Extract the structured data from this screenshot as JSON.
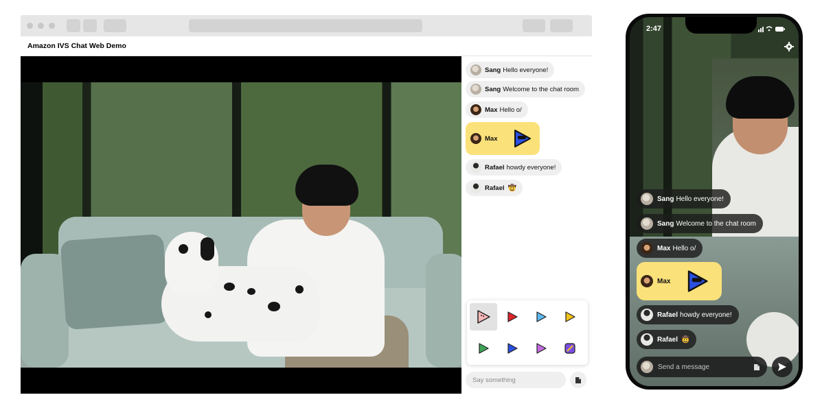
{
  "web": {
    "app_title": "Amazon IVS Chat Web Demo",
    "chat": {
      "messages": [
        {
          "user": "Sang",
          "text": "Hello everyone!",
          "avatar": "avatar-sang"
        },
        {
          "user": "Sang",
          "text": "Welcome to the chat room",
          "avatar": "avatar-sang"
        },
        {
          "user": "Max",
          "text": "Hello o/",
          "avatar": "avatar-max"
        },
        {
          "user": "Max",
          "text": "",
          "sticker": "blue-cool-sticker",
          "avatar": "avatar-max"
        },
        {
          "user": "Rafael",
          "text": "howdy everyone!",
          "avatar": "avatar-rafael"
        },
        {
          "user": "Rafael",
          "text": "",
          "emoji": "🤠",
          "avatar": "avatar-rafael"
        }
      ],
      "sticker_picker": {
        "stickers": [
          "pink-sticker",
          "red-sticker",
          "blue-sticker",
          "yellow-sticker",
          "green-sticker",
          "navy-sticker",
          "purple-sticker",
          "rocket-sticker"
        ],
        "selected_index": 0
      },
      "composer_placeholder": "Say something",
      "sticker_button_icon": "sticker-icon"
    }
  },
  "phone": {
    "time": "2:47",
    "status_icons": [
      "signal-icon",
      "wifi-icon",
      "battery-icon"
    ],
    "settings_icon": "gear-icon",
    "messages": [
      {
        "user": "Sang",
        "text": "Hello everyone!"
      },
      {
        "user": "Sang",
        "text": "Welcome to the chat room"
      },
      {
        "user": "Max",
        "text": "Hello o/"
      },
      {
        "user": "Max",
        "text": "",
        "sticker": "blue-cool-sticker"
      },
      {
        "user": "Rafael",
        "text": "howdy everyone!"
      },
      {
        "user": "Rafael",
        "text": "",
        "emoji": "🤠"
      }
    ],
    "composer_placeholder": "Send a message",
    "send_icon": "send-icon"
  },
  "colors": {
    "sticker_bubble": "#fbe17a",
    "web_bubble": "#efefef",
    "phone_bubble": "#1c1c1c",
    "sticker_blue": "#2b4fe0"
  }
}
